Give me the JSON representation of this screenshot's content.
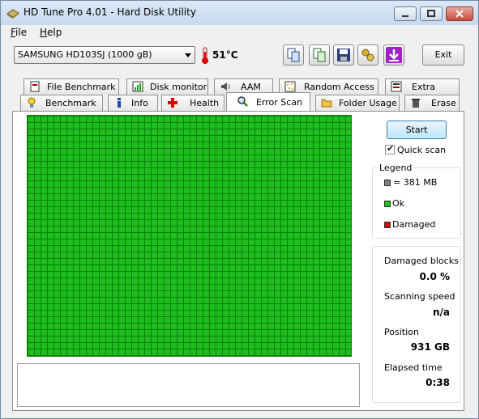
{
  "window": {
    "title": "HD Tune Pro 4.01 - Hard Disk Utility"
  },
  "menu": {
    "file_rest": "ile",
    "file_u": "F",
    "help_rest": "elp",
    "help_u": "H"
  },
  "toolbar": {
    "drive": "SAMSUNG HD103SJ (1000 gB)",
    "temperature": "51°C",
    "exit_label": "Exit"
  },
  "tabs_top": [
    {
      "label": "File Benchmark",
      "icon": "file-benchmark-icon"
    },
    {
      "label": "Disk monitor",
      "icon": "disk-monitor-icon"
    },
    {
      "label": "AAM",
      "icon": "speaker-icon"
    },
    {
      "label": "Random Access",
      "icon": "random-access-icon"
    },
    {
      "label": "Extra tests",
      "icon": "extra-tests-icon"
    }
  ],
  "tabs_bottom": [
    {
      "label": "Benchmark",
      "icon": "lightbulb-icon"
    },
    {
      "label": "Info",
      "icon": "info-icon"
    },
    {
      "label": "Health",
      "icon": "health-cross-icon"
    },
    {
      "label": "Error Scan",
      "icon": "magnifier-icon",
      "active": true
    },
    {
      "label": "Folder Usage",
      "icon": "folder-icon"
    },
    {
      "label": "Erase",
      "icon": "trash-icon"
    }
  ],
  "scan": {
    "start_label": "Start",
    "quick_scan_label": "Quick scan",
    "quick_scan_checked": true,
    "legend_title": "Legend",
    "legend_block": "= 381 MB",
    "legend_ok": "Ok",
    "legend_damaged": "Damaged",
    "colors": {
      "ok": "#1cbf1c",
      "damaged": "#e00000",
      "block": "#808080"
    }
  },
  "stats": {
    "damaged_label": "Damaged blocks",
    "damaged_value": "0.0 %",
    "speed_label": "Scanning speed",
    "speed_value": "n/a",
    "position_label": "Position",
    "position_value": "931 GB",
    "elapsed_label": "Elapsed time",
    "elapsed_value": "0:38"
  }
}
